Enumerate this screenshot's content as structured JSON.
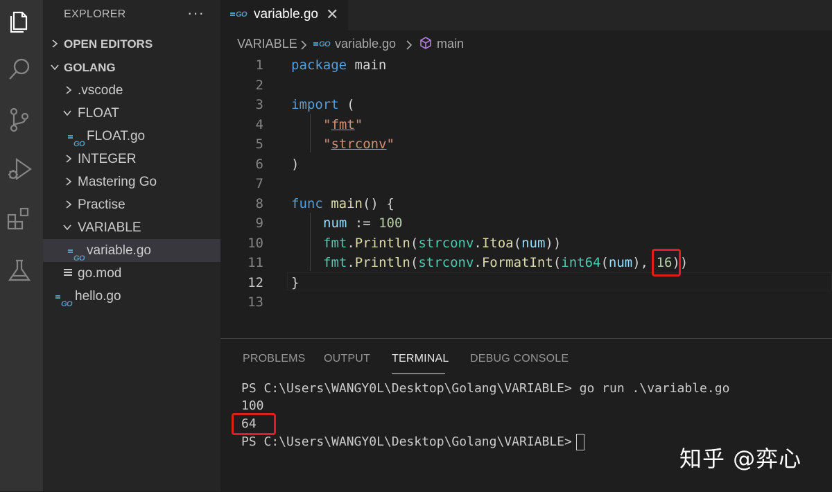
{
  "explorer": {
    "title": "EXPLORER",
    "more": "···",
    "sections": {
      "open_editors": "OPEN EDITORS",
      "workspace": "GOLANG"
    },
    "tree": [
      {
        "label": ".vscode"
      },
      {
        "label": "FLOAT"
      },
      {
        "label": "FLOAT.go"
      },
      {
        "label": "INTEGER"
      },
      {
        "label": "Mastering Go"
      },
      {
        "label": "Practise"
      },
      {
        "label": "VARIABLE"
      },
      {
        "label": "variable.go"
      },
      {
        "label": "go.mod"
      },
      {
        "label": "hello.go"
      }
    ]
  },
  "file_icon_text": "GO",
  "editor": {
    "tab": {
      "label": "variable.go",
      "close": "✕"
    },
    "breadcrumb": {
      "folder": "VARIABLE",
      "file": "variable.go",
      "symbol": "main"
    },
    "line_numbers": [
      "1",
      "2",
      "3",
      "4",
      "5",
      "6",
      "7",
      "8",
      "9",
      "10",
      "11",
      "12",
      "13"
    ],
    "code": {
      "l1": {
        "kw": "package",
        "rest": " main"
      },
      "l3": {
        "kw": "import",
        "rest": " ("
      },
      "l4": {
        "q1": "\"",
        "s": "fmt",
        "q2": "\""
      },
      "l5": {
        "q1": "\"",
        "s": "strconv",
        "q2": "\""
      },
      "l6": ")",
      "l8": {
        "kw": "func",
        "fn": "main",
        "rest": "() {"
      },
      "l9": {
        "var": "num",
        "op": " := ",
        "num": "100"
      },
      "l10": {
        "pkg": "fmt",
        "dot": ".",
        "fn": "Println",
        "p1": "(",
        "pkg2": "strconv",
        "dot2": ".",
        "fn2": "Itoa",
        "p2": "(",
        "var": "num",
        "p3": "))"
      },
      "l11": {
        "pkg": "fmt",
        "dot": ".",
        "fn": "Println",
        "p1": "(",
        "pkg2": "strconv",
        "dot2": ".",
        "fn2": "FormatInt",
        "p2": "(",
        "ty": "int64",
        "p3": "(",
        "var": "num",
        "p4": "), ",
        "num": "16",
        "p5": "))"
      },
      "l12": "}"
    }
  },
  "panel": {
    "tabs": [
      "PROBLEMS",
      "OUTPUT",
      "TERMINAL",
      "DEBUG CONSOLE"
    ],
    "terminal_lines": [
      "PS C:\\Users\\WANGY0L\\Desktop\\Golang\\VARIABLE> go run .\\variable.go",
      "100",
      "64",
      "PS C:\\Users\\WANGY0L\\Desktop\\Golang\\VARIABLE>"
    ]
  },
  "watermark": "知乎 @弈心"
}
